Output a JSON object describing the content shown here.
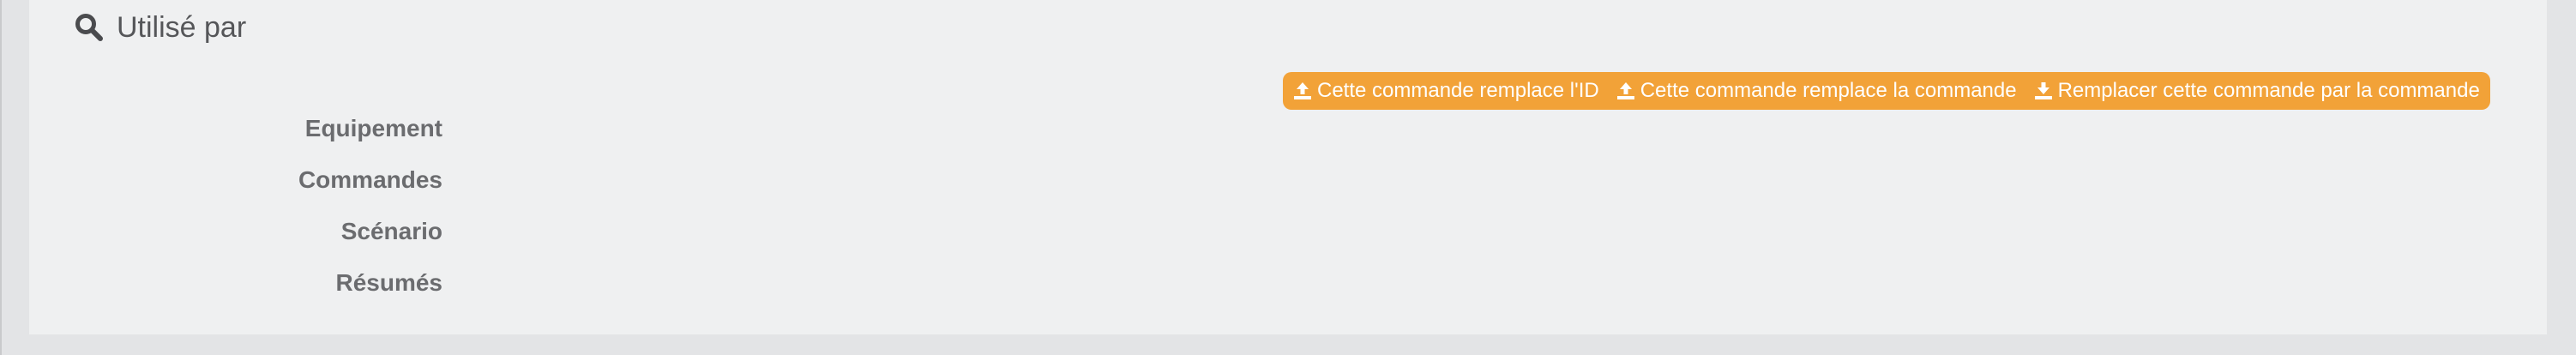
{
  "panel": {
    "title": "Utilisé par",
    "title_icon": "search-icon"
  },
  "actions": [
    {
      "label": "Cette commande remplace l'ID",
      "icon": "upload-icon"
    },
    {
      "label": "Cette commande remplace la commande",
      "icon": "upload-icon"
    },
    {
      "label": "Remplacer cette commande par la commande",
      "icon": "download-icon"
    }
  ],
  "fields": [
    {
      "label": "Equipement"
    },
    {
      "label": "Commandes"
    },
    {
      "label": "Scénario"
    },
    {
      "label": "Résumés"
    }
  ],
  "colors": {
    "accent": "#f2a238",
    "panel_bg": "#eff0f1",
    "page_bg": "#e3e4e6",
    "label_text": "#6b6c6f"
  }
}
